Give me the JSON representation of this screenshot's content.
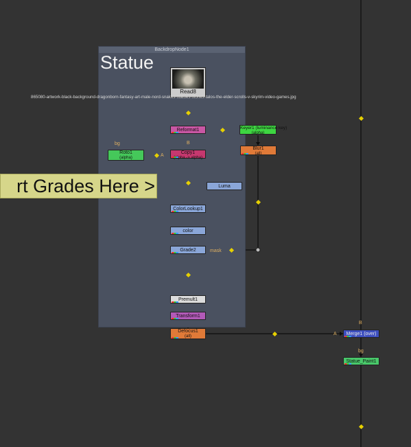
{
  "backdrop": {
    "name": "BackdropNode1",
    "title": "Statue"
  },
  "read_node": {
    "name": "Read8",
    "filename": "865080-artwork-black-background-dragonborn-fantasy-art-male-nord-snakes-statues-stones-talos-the-elder-scrolls-v-skyrim-video-games.jpg"
  },
  "sticky_note": {
    "text": "rt Grades Here >"
  },
  "nodes": {
    "reformat": {
      "label": "Reformat1"
    },
    "keyer": {
      "label": "Keyer1 (luminance key)",
      "sub": "(alpha)"
    },
    "blur": {
      "label": "Blur1",
      "sub": "(all)"
    },
    "roto": {
      "label": "Roto1",
      "sub": "(alpha)"
    },
    "copy": {
      "label": "Copy1",
      "sub": "(alpha -> alpha)"
    },
    "luma": {
      "label": "Luma"
    },
    "colorlookup": {
      "label": "ColorLookup1"
    },
    "color": {
      "label": "color"
    },
    "grade": {
      "label": "Grade2"
    },
    "premult": {
      "label": "Premult1"
    },
    "transform": {
      "label": "Transform1"
    },
    "defocus": {
      "label": "Defocus1",
      "sub": "(all)"
    },
    "merge": {
      "label": "Merge1 (over)"
    },
    "statue_paint": {
      "label": "Statue_Paint1"
    }
  },
  "edge_labels": {
    "copy_b": "B",
    "copy_a": "A",
    "roto_bg": "bg",
    "mask": "mask",
    "merge_b": "B",
    "merge_a": "A",
    "paint_bg": "bg"
  },
  "colors": {
    "reformat": "#c857a4",
    "keyer": "#3ed641",
    "blur": "#e07a38",
    "roto": "#45c85a",
    "copy": "#c6386f",
    "luma": "#8aa6d8",
    "colorlookup": "#8aa6d8",
    "grade": "#8aa6d8",
    "premult": "#dcdcdc",
    "transform": "#b25ab8",
    "defocus": "#e07a38",
    "merge": "#3d4fbf",
    "statue_paint": "#49c86a"
  }
}
